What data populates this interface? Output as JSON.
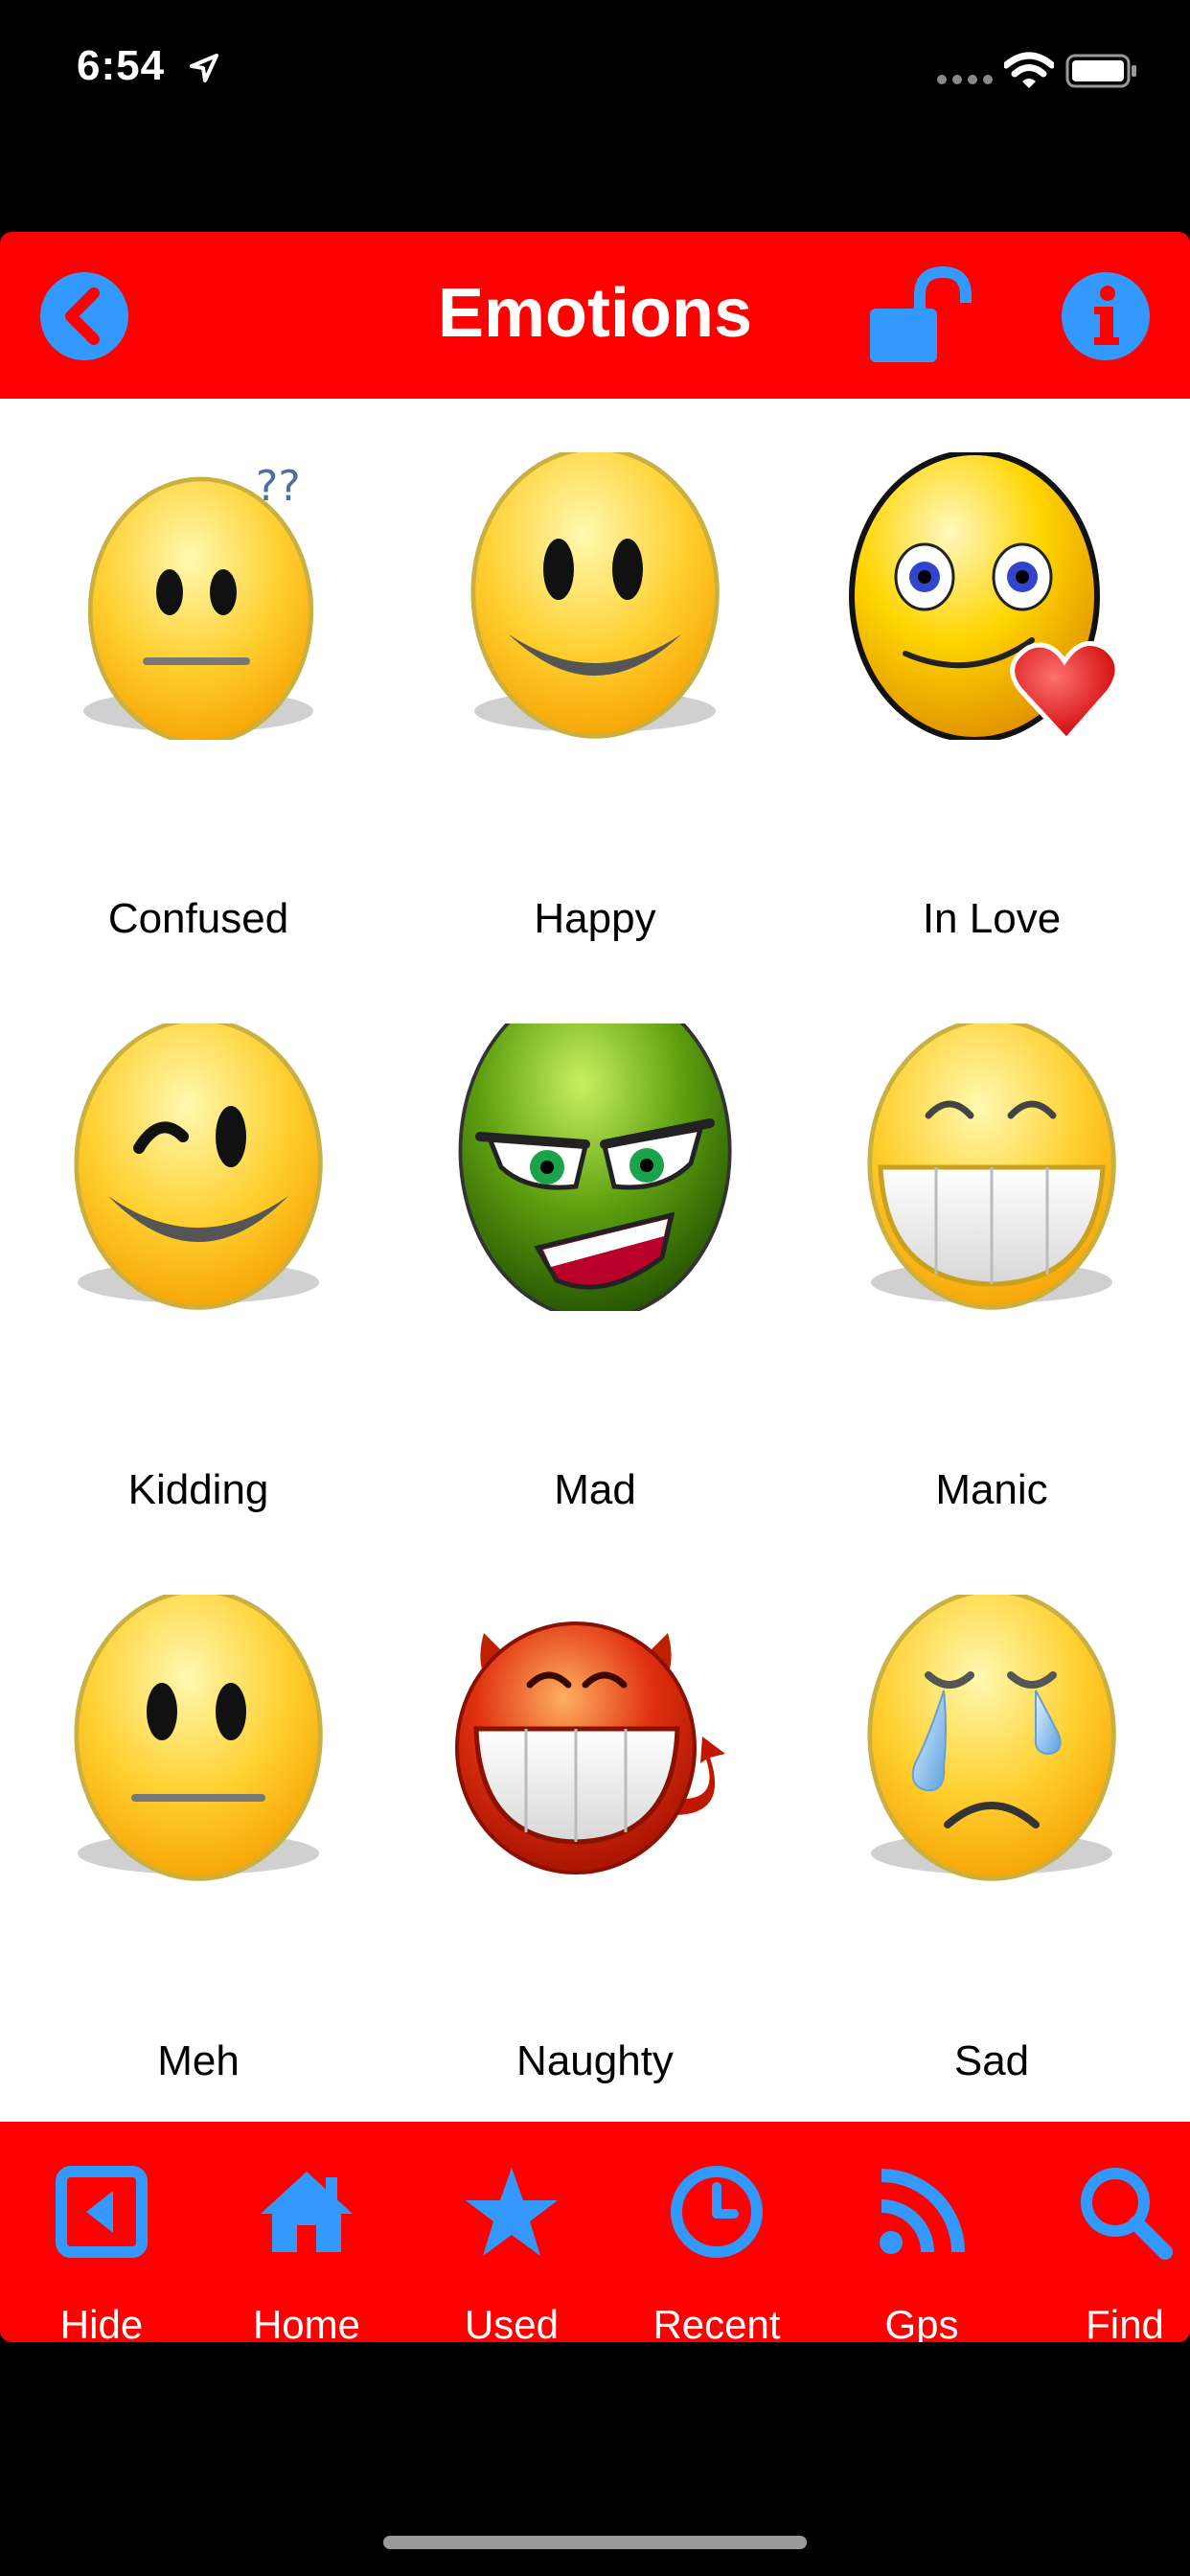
{
  "status_bar": {
    "time": "6:54"
  },
  "nav": {
    "title": "Emotions",
    "colors": {
      "bar": "#ff0000",
      "icon": "#3399ff",
      "title": "#ffffff"
    },
    "icons": [
      "back-chevron-icon",
      "unlock-icon",
      "info-icon"
    ]
  },
  "emotions": [
    {
      "label": "Confused",
      "icon": "confused-face-icon"
    },
    {
      "label": "Happy",
      "icon": "happy-face-icon"
    },
    {
      "label": "In Love",
      "icon": "in-love-face-icon"
    },
    {
      "label": "Kidding",
      "icon": "wink-face-icon"
    },
    {
      "label": "Mad",
      "icon": "mad-face-icon"
    },
    {
      "label": "Manic",
      "icon": "manic-face-icon"
    },
    {
      "label": "Meh",
      "icon": "meh-face-icon"
    },
    {
      "label": "Naughty",
      "icon": "devil-face-icon"
    },
    {
      "label": "Sad",
      "icon": "sad-face-icon"
    }
  ],
  "tab_bar": {
    "items": [
      {
        "label": "Hide",
        "icon": "hide-icon"
      },
      {
        "label": "Home",
        "icon": "home-icon"
      },
      {
        "label": "Used",
        "icon": "star-icon"
      },
      {
        "label": "Recent",
        "icon": "clock-icon"
      },
      {
        "label": "Gps",
        "icon": "rss-icon"
      },
      {
        "label": "Find",
        "icon": "search-icon"
      }
    ]
  }
}
